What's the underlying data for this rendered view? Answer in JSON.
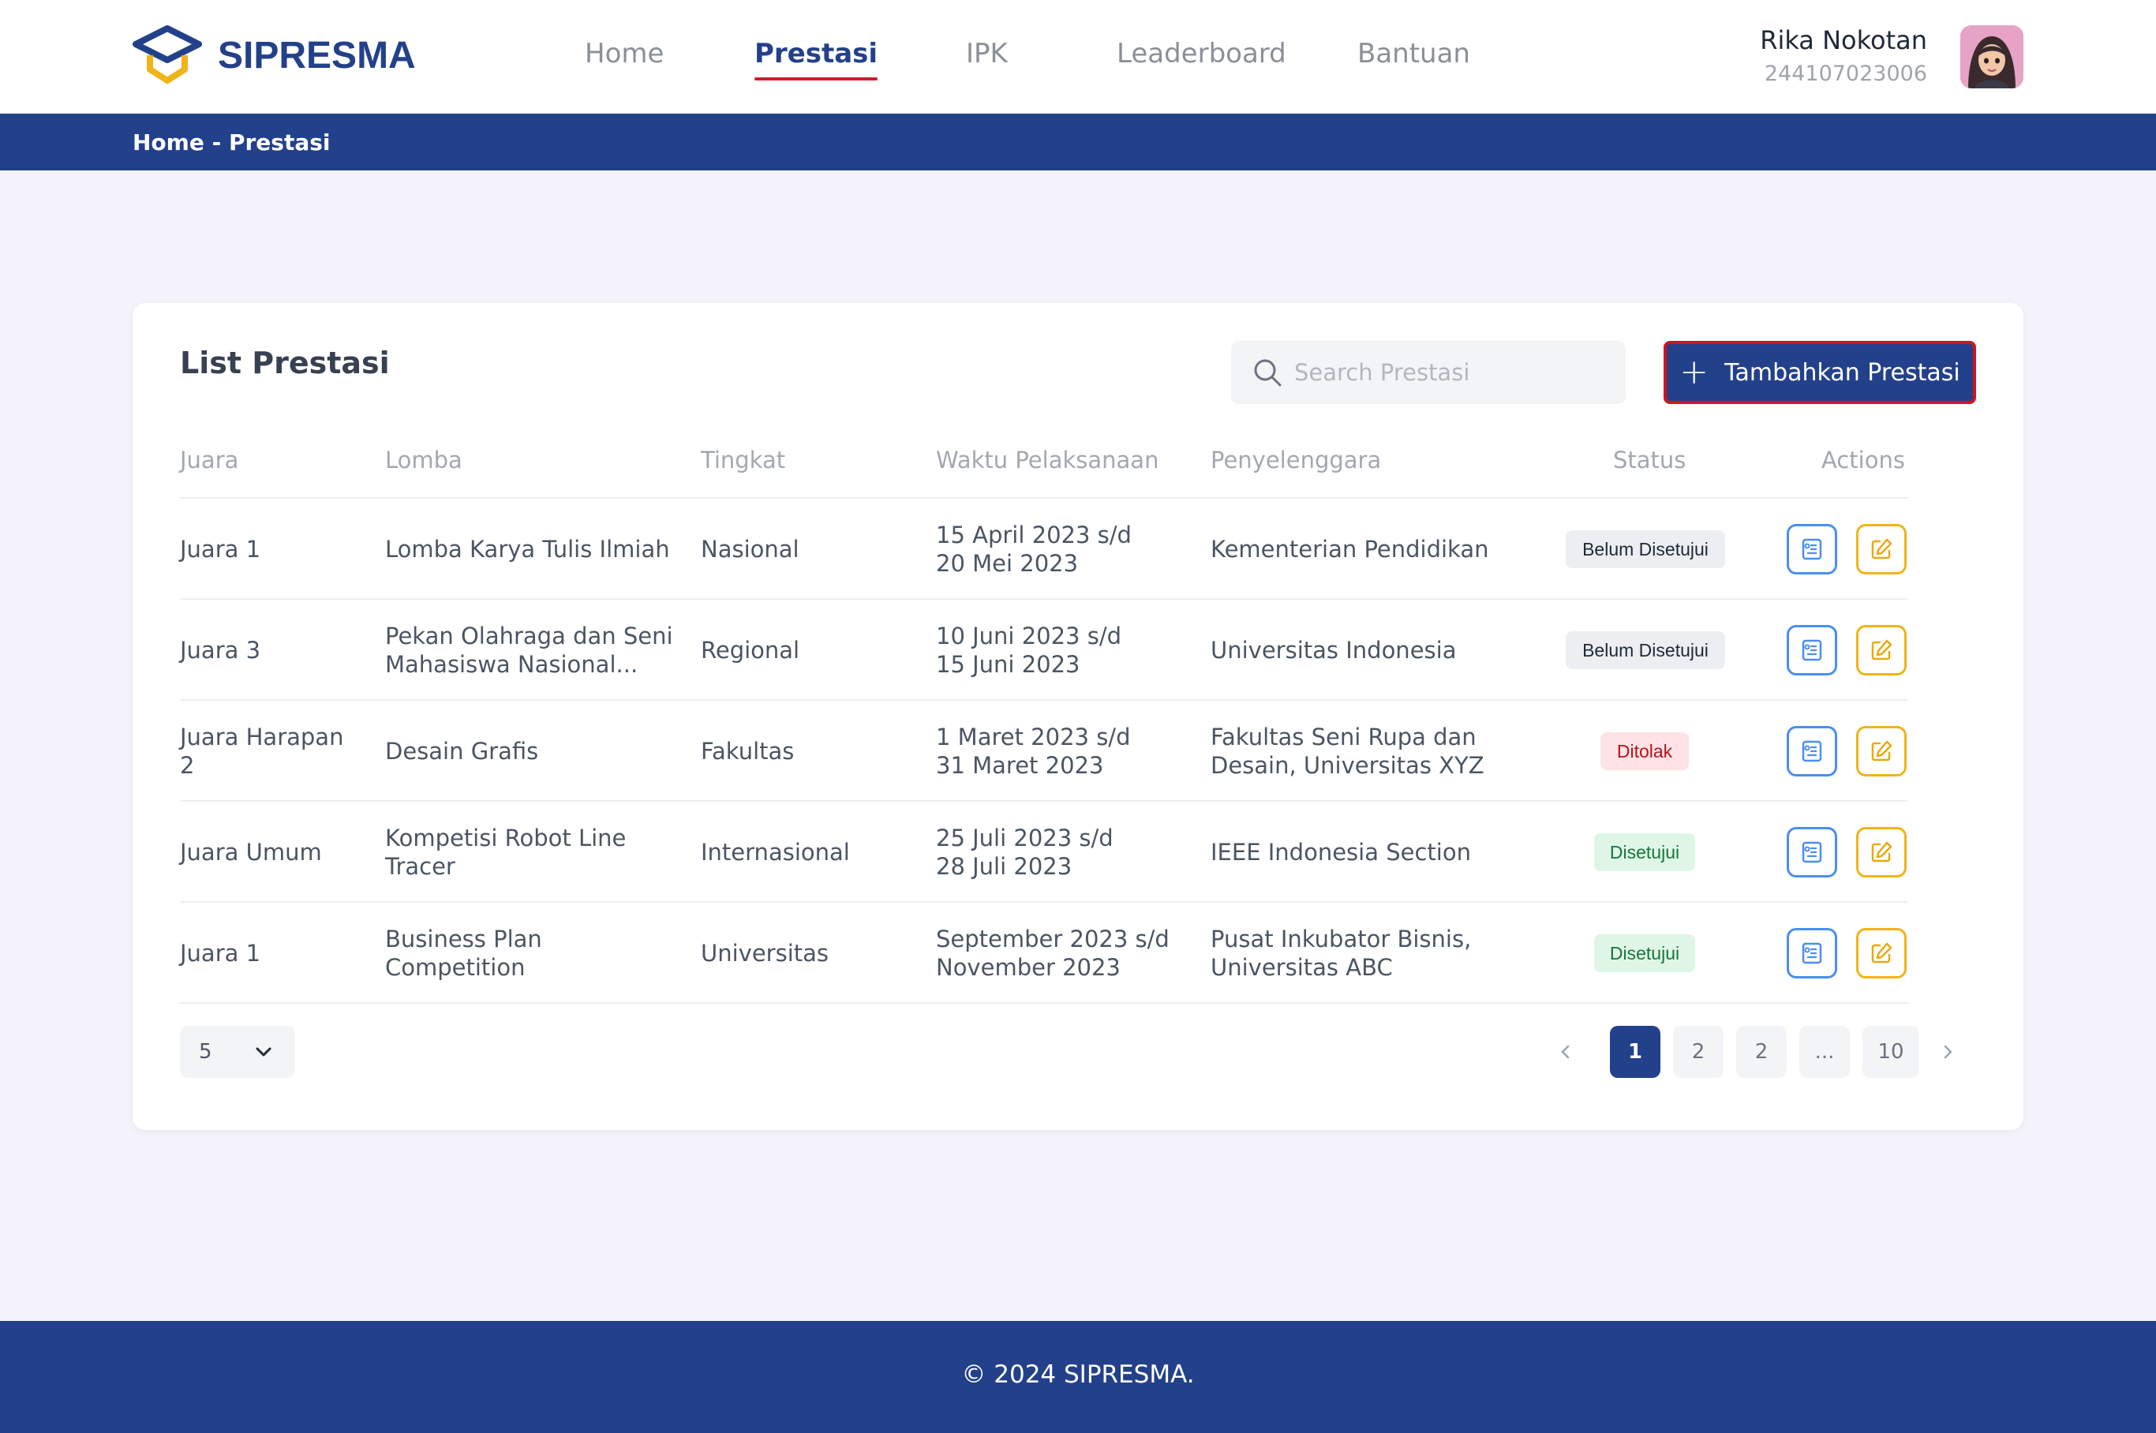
{
  "app": {
    "name": "SIPRESMA"
  },
  "nav": {
    "items": [
      {
        "label": "Home"
      },
      {
        "label": "Prestasi"
      },
      {
        "label": "IPK"
      },
      {
        "label": "Leaderboard"
      },
      {
        "label": "Bantuan"
      }
    ],
    "active": "Prestasi"
  },
  "user": {
    "name": "Rika Nokotan",
    "id": "244107023006"
  },
  "breadcrumb": "Home - Prestasi",
  "card": {
    "title": "List Prestasi",
    "search_placeholder": "Search Prestasi",
    "add_label": "Tambahkan Prestasi"
  },
  "table": {
    "headers": {
      "juara": "Juara",
      "lomba": "Lomba",
      "tingkat": "Tingkat",
      "waktu": "Waktu Pelaksanaan",
      "penyelenggara": "Penyelenggara",
      "status": "Status",
      "actions": "Actions"
    },
    "rows": [
      {
        "juara": "Juara 1",
        "lomba": "Lomba Karya Tulis Ilmiah",
        "tingkat": "Nasional",
        "waktu_1": "15 April 2023 s/d",
        "waktu_2": "20 Mei 2023",
        "penyelenggara_1": "Kementerian Pendidikan",
        "penyelenggara_2": "",
        "status": "Belum Disetujui",
        "status_type": "pending"
      },
      {
        "juara": "Juara 3",
        "lomba": "Pekan Olahraga dan Seni Mahasiswa Nasional...",
        "tingkat": "Regional",
        "waktu_1": "10 Juni 2023 s/d",
        "waktu_2": "15 Juni 2023",
        "penyelenggara_1": "Universitas Indonesia",
        "penyelenggara_2": "",
        "status": "Belum Disetujui",
        "status_type": "pending"
      },
      {
        "juara": "Juara Harapan 2",
        "lomba": "Desain Grafis",
        "tingkat": "Fakultas",
        "waktu_1": "1 Maret 2023 s/d",
        "waktu_2": "31 Maret 2023",
        "penyelenggara_1": "Fakultas Seni Rupa dan",
        "penyelenggara_2": "Desain, Universitas XYZ",
        "status": "Ditolak",
        "status_type": "rejected"
      },
      {
        "juara": "Juara Umum",
        "lomba": "Kompetisi Robot Line Tracer",
        "tingkat": "Internasional",
        "waktu_1": "25 Juli 2023 s/d",
        "waktu_2": "28 Juli 2023",
        "penyelenggara_1": "IEEE Indonesia Section",
        "penyelenggara_2": "",
        "status": "Disetujui",
        "status_type": "approved"
      },
      {
        "juara": "Juara 1",
        "lomba": "Business Plan Competition",
        "tingkat": "Universitas",
        "waktu_1": "September 2023 s/d",
        "waktu_2": "November 2023",
        "penyelenggara_1": "Pusat Inkubator Bisnis,",
        "penyelenggara_2": "Universitas ABC",
        "status": "Disetujui",
        "status_type": "approved"
      }
    ]
  },
  "pagination": {
    "page_size": "5",
    "pages": [
      "1",
      "2",
      "2",
      "...",
      "10"
    ],
    "current": "1"
  },
  "footer": "© 2024 SIPRESMA.",
  "colors": {
    "primary": "#23418a",
    "accent_red": "#cc1f2d",
    "view_border": "#4a8ff0",
    "edit_border": "#f0b419",
    "background": "#f4f2fb"
  }
}
